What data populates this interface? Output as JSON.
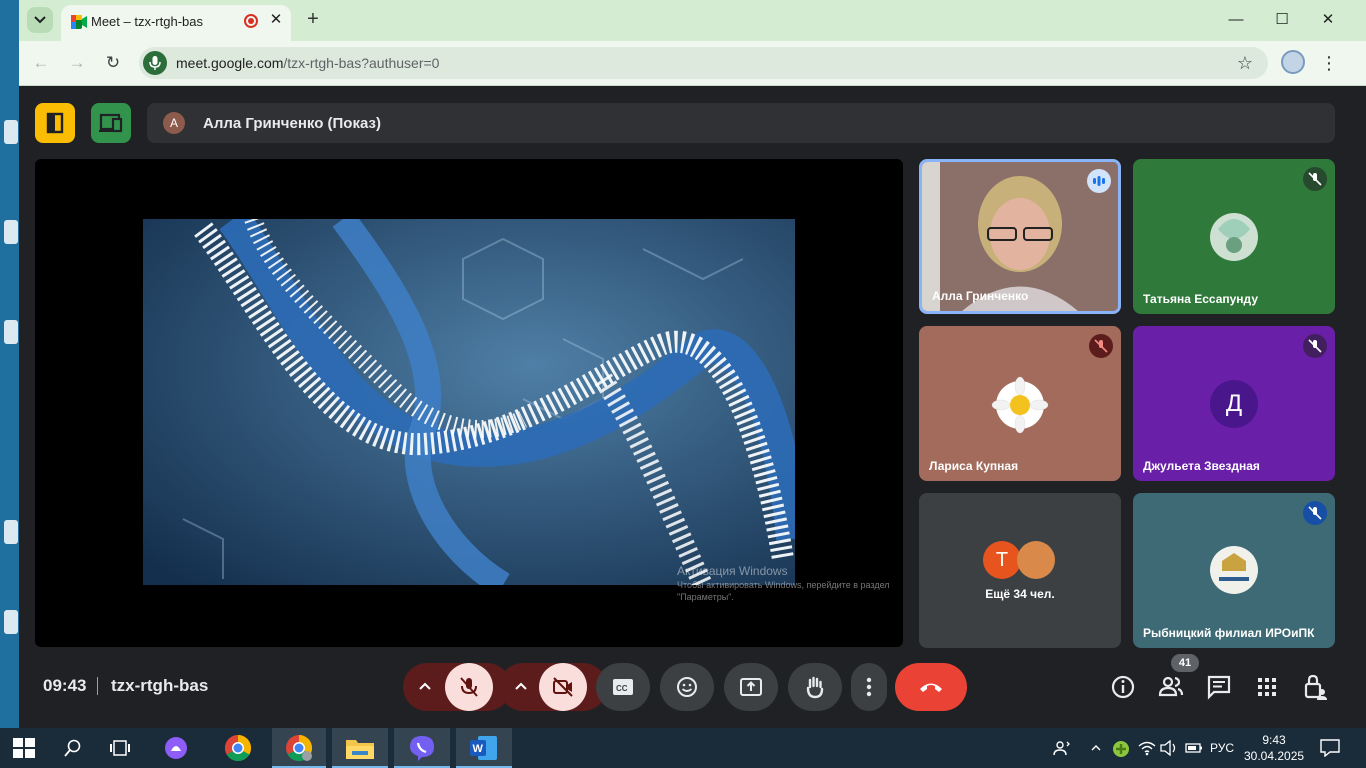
{
  "browser": {
    "tab_title": "Meet – tzx-rtgh-bas",
    "url_host": "meet.google.com",
    "url_path": "/tzx-rtgh-bas?authuser=0"
  },
  "meet": {
    "presenter_initial": "A",
    "presenter_label": "Алла Гринченко (Показ)",
    "activation_title": "Активация Windows",
    "activation_text": "Чтобы активировать Windows, перейдите в раздел \"Параметры\".",
    "tiles": [
      {
        "name": "Алла Гринченко",
        "state": "speaking"
      },
      {
        "name": "Татьяна Ессапунду",
        "state": "muted"
      },
      {
        "name": "Лариса Купная",
        "state": "muted"
      },
      {
        "name": "Джульета Звездная",
        "initial": "Д",
        "state": "muted"
      },
      {
        "name": "Ещё 34 чел.",
        "initial": "Т"
      },
      {
        "name": "Рыбницкий филиал ИРОиПК",
        "state": "muted"
      }
    ],
    "time": "09:43",
    "meeting_code": "tzx-rtgh-bas",
    "participants_count": "41"
  },
  "taskbar": {
    "language": "РУС",
    "time": "9:43",
    "date": "30.04.2025"
  },
  "colors": {
    "leave": "#ea4335",
    "muted_bg": "#f9dedc",
    "tab_strip": "#d3ecd2"
  }
}
